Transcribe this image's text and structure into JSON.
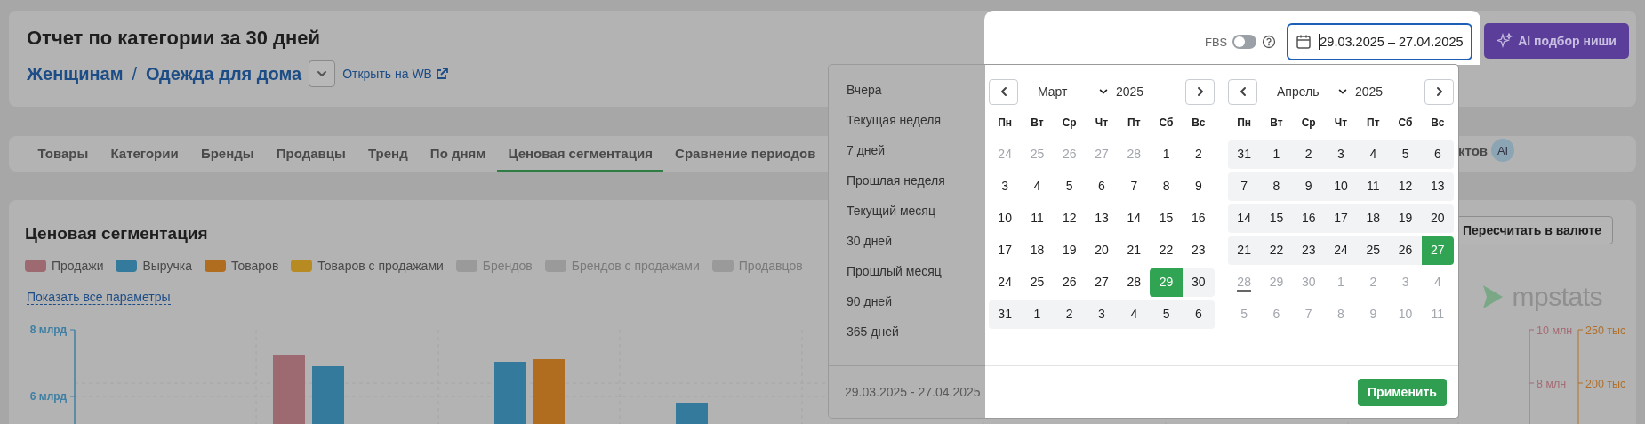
{
  "header": {
    "title": "Отчет по категории за 30 дней",
    "breadcrumbs": [
      "Женщинам",
      "Одежда для дома"
    ],
    "separator": "/",
    "open_link": "Открыть на WB"
  },
  "toolbar": {
    "fbs_label": "FBS",
    "fbs_on": false,
    "date_value": "29.03.2025 – 27.04.2025",
    "ai_button": "AI подбор ниши"
  },
  "tabs": [
    {
      "label": "Товары",
      "selected": false
    },
    {
      "label": "Категории",
      "selected": false
    },
    {
      "label": "Бренды",
      "selected": false
    },
    {
      "label": "Продавцы",
      "selected": false
    },
    {
      "label": "Тренд",
      "selected": false
    },
    {
      "label": "По дням",
      "selected": false
    },
    {
      "label": "Ценовая сегментация",
      "selected": true
    },
    {
      "label": "Сравнение периодов",
      "selected": false
    }
  ],
  "tab_tail": {
    "label": "ктов",
    "badge": "AI"
  },
  "chart_card": {
    "title": "Ценовая сегментация",
    "recalc_button": "Пересчитать в валюте",
    "legend": [
      {
        "label": "Продажи",
        "color": "#9e6a72",
        "enabled": true
      },
      {
        "label": "Выручка",
        "color": "#347a9c",
        "enabled": true
      },
      {
        "label": "Товаров",
        "color": "#b06d20",
        "enabled": true
      },
      {
        "label": "Товаров с продажами",
        "color": "#b88a22",
        "enabled": true
      },
      {
        "label": "Брендов",
        "color": "#9a9a9a",
        "enabled": false
      },
      {
        "label": "Брендов с продажами",
        "color": "#9a9a9a",
        "enabled": false
      },
      {
        "label": "Продавцов",
        "color": "#9a9a9a",
        "enabled": false
      }
    ],
    "show_all_link": "Показать все параметры",
    "logo": "mpstats",
    "left_ticks": [
      "8 млрд",
      "6 млрд"
    ],
    "right_ticks_a": [
      "10 млн",
      "8 млн"
    ],
    "right_ticks_b": [
      "250 тыс",
      "200 тыс"
    ]
  },
  "date_picker": {
    "presets": [
      "Вчера",
      "Текущая неделя",
      "7 дней",
      "Прошлая неделя",
      "Текущий месяц",
      "30 дней",
      "Прошлый месяц",
      "90 дней",
      "365 дней"
    ],
    "footer_range": "29.03.2025 - 27.04.2025",
    "apply_button": "Применить",
    "calendars": [
      {
        "month": "Март",
        "year": "2025",
        "weekdays": [
          "Пн",
          "Вт",
          "Ср",
          "Чт",
          "Пт",
          "Сб",
          "Вс"
        ],
        "weeks": [
          [
            {
              "d": "24",
              "kind": "muted"
            },
            {
              "d": "25",
              "kind": "muted"
            },
            {
              "d": "26",
              "kind": "muted"
            },
            {
              "d": "27",
              "kind": "muted"
            },
            {
              "d": "28",
              "kind": "muted"
            },
            {
              "d": "1",
              "kind": "normal"
            },
            {
              "d": "2",
              "kind": "normal"
            }
          ],
          [
            {
              "d": "3",
              "kind": "normal"
            },
            {
              "d": "4",
              "kind": "normal"
            },
            {
              "d": "5",
              "kind": "normal"
            },
            {
              "d": "6",
              "kind": "normal"
            },
            {
              "d": "7",
              "kind": "normal"
            },
            {
              "d": "8",
              "kind": "normal"
            },
            {
              "d": "9",
              "kind": "normal"
            }
          ],
          [
            {
              "d": "10",
              "kind": "normal"
            },
            {
              "d": "11",
              "kind": "normal"
            },
            {
              "d": "12",
              "kind": "normal"
            },
            {
              "d": "13",
              "kind": "normal"
            },
            {
              "d": "14",
              "kind": "normal"
            },
            {
              "d": "15",
              "kind": "normal"
            },
            {
              "d": "16",
              "kind": "normal"
            }
          ],
          [
            {
              "d": "17",
              "kind": "normal"
            },
            {
              "d": "18",
              "kind": "normal"
            },
            {
              "d": "19",
              "kind": "normal"
            },
            {
              "d": "20",
              "kind": "normal"
            },
            {
              "d": "21",
              "kind": "normal"
            },
            {
              "d": "22",
              "kind": "normal"
            },
            {
              "d": "23",
              "kind": "normal"
            }
          ],
          [
            {
              "d": "24",
              "kind": "normal"
            },
            {
              "d": "25",
              "kind": "normal"
            },
            {
              "d": "26",
              "kind": "normal"
            },
            {
              "d": "27",
              "kind": "normal"
            },
            {
              "d": "28",
              "kind": "normal"
            },
            {
              "d": "29",
              "kind": "selected"
            },
            {
              "d": "30",
              "kind": "range"
            }
          ],
          [
            {
              "d": "31",
              "kind": "range"
            },
            {
              "d": "1",
              "kind": "range"
            },
            {
              "d": "2",
              "kind": "range"
            },
            {
              "d": "3",
              "kind": "range"
            },
            {
              "d": "4",
              "kind": "range"
            },
            {
              "d": "5",
              "kind": "range"
            },
            {
              "d": "6",
              "kind": "range"
            }
          ]
        ]
      },
      {
        "month": "Апрель",
        "year": "2025",
        "weekdays": [
          "Пн",
          "Вт",
          "Ср",
          "Чт",
          "Пт",
          "Сб",
          "Вс"
        ],
        "weeks": [
          [
            {
              "d": "31",
              "kind": "range"
            },
            {
              "d": "1",
              "kind": "range"
            },
            {
              "d": "2",
              "kind": "range"
            },
            {
              "d": "3",
              "kind": "range"
            },
            {
              "d": "4",
              "kind": "range"
            },
            {
              "d": "5",
              "kind": "range"
            },
            {
              "d": "6",
              "kind": "range"
            }
          ],
          [
            {
              "d": "7",
              "kind": "range"
            },
            {
              "d": "8",
              "kind": "range"
            },
            {
              "d": "9",
              "kind": "range"
            },
            {
              "d": "10",
              "kind": "range"
            },
            {
              "d": "11",
              "kind": "range"
            },
            {
              "d": "12",
              "kind": "range"
            },
            {
              "d": "13",
              "kind": "range"
            }
          ],
          [
            {
              "d": "14",
              "kind": "range"
            },
            {
              "d": "15",
              "kind": "range"
            },
            {
              "d": "16",
              "kind": "range"
            },
            {
              "d": "17",
              "kind": "range"
            },
            {
              "d": "18",
              "kind": "range"
            },
            {
              "d": "19",
              "kind": "range"
            },
            {
              "d": "20",
              "kind": "range"
            }
          ],
          [
            {
              "d": "21",
              "kind": "range"
            },
            {
              "d": "22",
              "kind": "range"
            },
            {
              "d": "23",
              "kind": "range"
            },
            {
              "d": "24",
              "kind": "range"
            },
            {
              "d": "25",
              "kind": "range"
            },
            {
              "d": "26",
              "kind": "range"
            },
            {
              "d": "27",
              "kind": "selected"
            }
          ],
          [
            {
              "d": "28",
              "kind": "today"
            },
            {
              "d": "29",
              "kind": "muted"
            },
            {
              "d": "30",
              "kind": "muted"
            },
            {
              "d": "1",
              "kind": "muted"
            },
            {
              "d": "2",
              "kind": "muted"
            },
            {
              "d": "3",
              "kind": "muted"
            },
            {
              "d": "4",
              "kind": "muted"
            }
          ],
          [
            {
              "d": "5",
              "kind": "muted"
            },
            {
              "d": "6",
              "kind": "muted"
            },
            {
              "d": "7",
              "kind": "muted"
            },
            {
              "d": "8",
              "kind": "muted"
            },
            {
              "d": "9",
              "kind": "muted"
            },
            {
              "d": "10",
              "kind": "muted"
            },
            {
              "d": "11",
              "kind": "muted"
            }
          ]
        ]
      }
    ]
  }
}
